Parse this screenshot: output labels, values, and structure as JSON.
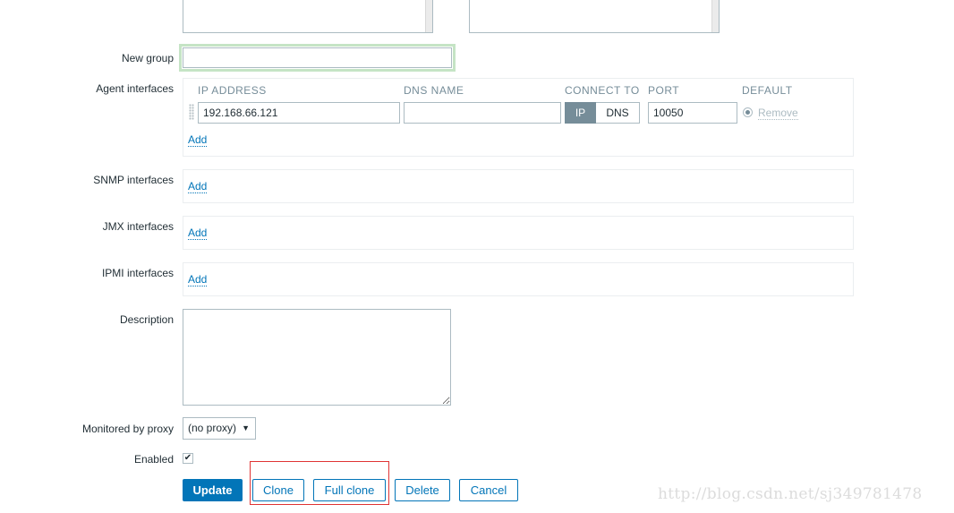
{
  "form": {
    "new_group": {
      "label": "New group",
      "value": "",
      "placeholder": ""
    },
    "agent_interfaces": {
      "label": "Agent interfaces",
      "columns": [
        "IP ADDRESS",
        "DNS NAME",
        "CONNECT TO",
        "PORT",
        "DEFAULT"
      ],
      "row": {
        "ip": "192.168.66.121",
        "dns": "",
        "connect_ip": "IP",
        "connect_dns": "DNS",
        "connect_selected": "IP",
        "port": "10050",
        "remove": "Remove"
      },
      "add": "Add"
    },
    "snmp_interfaces": {
      "label": "SNMP interfaces",
      "add": "Add"
    },
    "jmx_interfaces": {
      "label": "JMX interfaces",
      "add": "Add"
    },
    "ipmi_interfaces": {
      "label": "IPMI interfaces",
      "add": "Add"
    },
    "description": {
      "label": "Description",
      "value": ""
    },
    "monitored_by_proxy": {
      "label": "Monitored by proxy",
      "value": "(no proxy)"
    },
    "enabled": {
      "label": "Enabled",
      "checked": true,
      "check_glyph": "✔"
    }
  },
  "buttons": {
    "update": "Update",
    "clone": "Clone",
    "full_clone": "Full clone",
    "delete": "Delete",
    "cancel": "Cancel"
  },
  "watermark": "http://blog.csdn.net/sj349781478",
  "colors": {
    "accent": "#0275b8",
    "segment_active": "#768d99",
    "highlight_box": "#e03333",
    "focus_glow": "#c5e4c5"
  }
}
